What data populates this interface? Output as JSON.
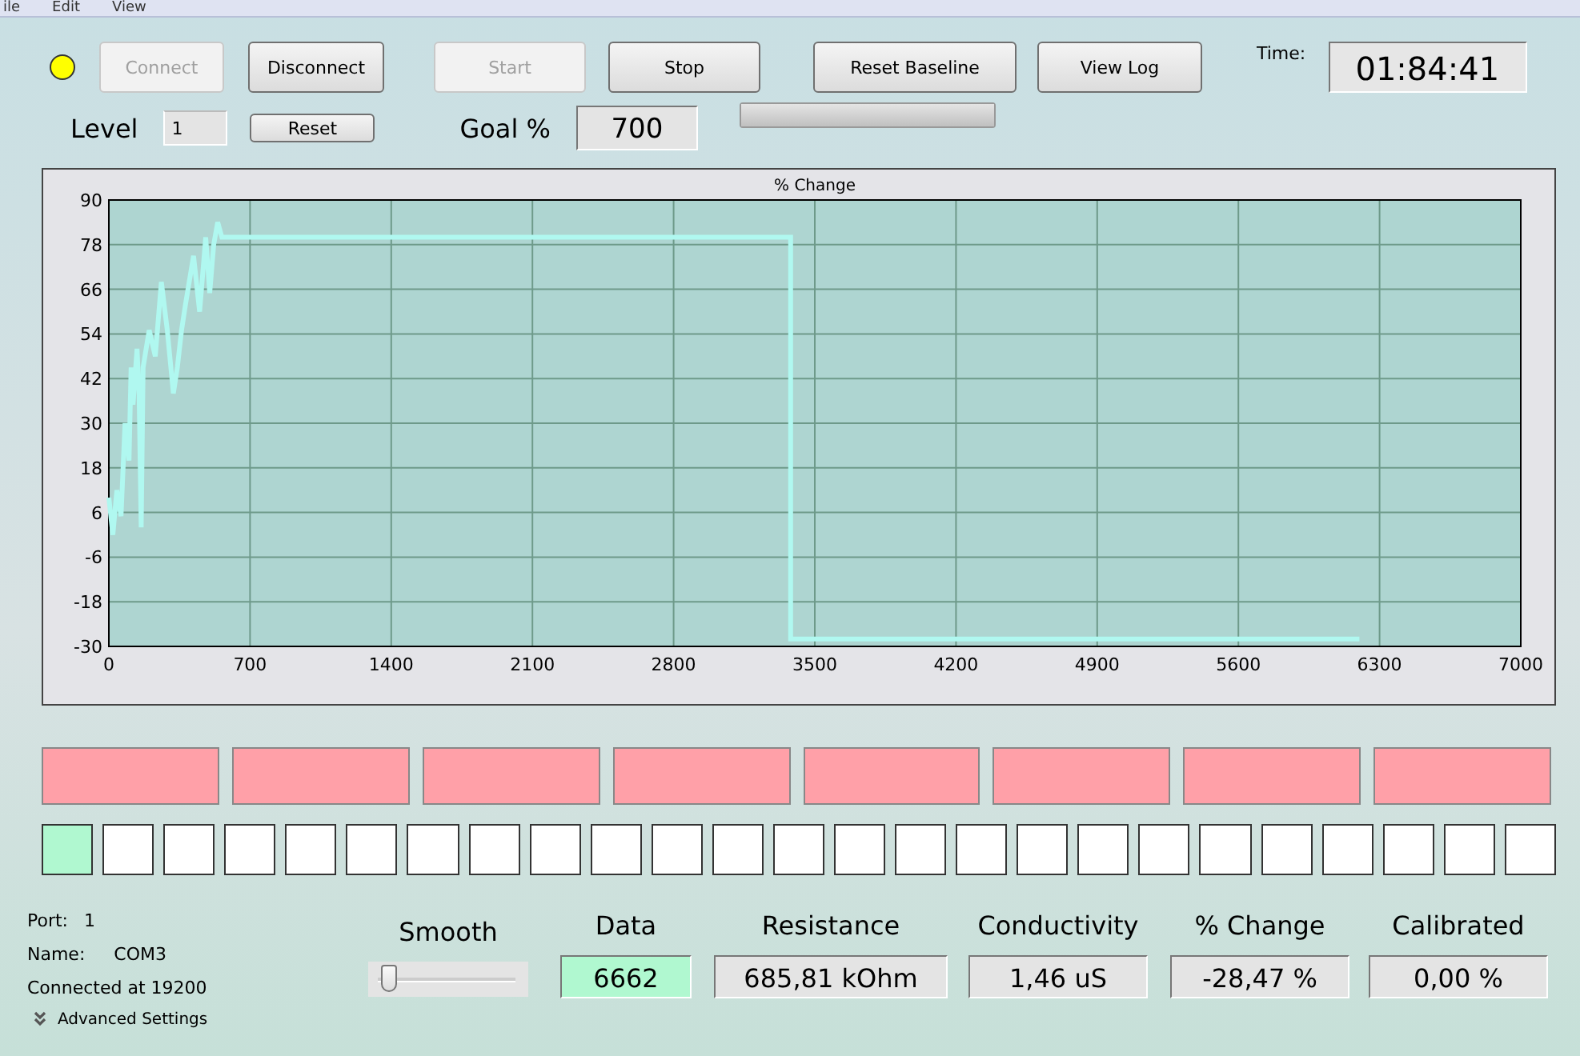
{
  "menu": [
    "ile",
    "Edit",
    "View"
  ],
  "status_dot": {
    "color": "#ffff00"
  },
  "buttons": [
    {
      "label": "Connect",
      "disabled": true
    },
    {
      "label": "Disconnect",
      "disabled": false
    },
    {
      "label": "Start",
      "disabled": true
    },
    {
      "label": "Stop",
      "disabled": false
    },
    {
      "label": "Reset Baseline",
      "disabled": false
    },
    {
      "label": "View Log",
      "disabled": false
    }
  ],
  "time": {
    "label": "Time:",
    "value": "01:84:41"
  },
  "level": {
    "label": "Level",
    "value": "1",
    "reset": "Reset"
  },
  "goal": {
    "label": "Goal %",
    "value": "700",
    "progress": {
      "level": 1
    }
  },
  "chart": {
    "chart_data": {
      "type": "line",
      "title": "% Change",
      "grid": true,
      "xlim": [
        0,
        7000
      ],
      "ylim": [
        -30,
        90
      ],
      "xticks": [
        0,
        700,
        1400,
        2100,
        2800,
        3500,
        4200,
        4900,
        5600,
        6300,
        7000
      ],
      "yticks": [
        -30,
        -18,
        -6,
        6,
        18,
        30,
        42,
        54,
        66,
        78,
        90
      ],
      "x": [
        0,
        20,
        40,
        60,
        80,
        100,
        110,
        120,
        140,
        150,
        160,
        170,
        200,
        230,
        260,
        290,
        320,
        340,
        360,
        380,
        420,
        450,
        480,
        500,
        520,
        540,
        560,
        3380,
        3380,
        6200
      ],
      "series": [
        {
          "color": "#b0f8f0",
          "values": [
            10,
            0,
            12,
            5,
            30,
            20,
            45,
            35,
            50,
            38,
            2,
            45,
            55,
            48,
            68,
            55,
            38,
            45,
            55,
            62,
            75,
            60,
            80,
            65,
            78,
            84,
            80,
            80,
            -28,
            -28
          ]
        }
      ]
    }
  },
  "indicators": [
    {
      "color": "#ffa0a8"
    },
    {
      "color": "#ffa0a8"
    },
    {
      "color": "#ffa0a8"
    },
    {
      "color": "#ffa0a8"
    },
    {
      "color": "#ffa0a8"
    },
    {
      "color": "#ffa0a8"
    },
    {
      "color": "#ffa0a8"
    },
    {
      "color": "#ffa0a8"
    }
  ],
  "lights": [
    {
      "on": true
    },
    {
      "on": false
    },
    {
      "on": false
    },
    {
      "on": false
    },
    {
      "on": false
    },
    {
      "on": false
    },
    {
      "on": false
    },
    {
      "on": false
    },
    {
      "on": false
    },
    {
      "on": false
    },
    {
      "on": false
    },
    {
      "on": false
    },
    {
      "on": false
    },
    {
      "on": false
    },
    {
      "on": false
    },
    {
      "on": false
    },
    {
      "on": false
    },
    {
      "on": false
    },
    {
      "on": false
    },
    {
      "on": false
    },
    {
      "on": false
    },
    {
      "on": false
    },
    {
      "on": false
    },
    {
      "on": false
    },
    {
      "on": false
    }
  ],
  "port": {
    "port_label": "Port:",
    "port_value": "1",
    "name_label": "Name:",
    "name_value": "COM3",
    "status": "Connected at 19200",
    "advanced": "Advanced Settings"
  },
  "smooth": {
    "label": "Smooth",
    "level": 0.05
  },
  "readouts": [
    {
      "label": "Data",
      "value": "6662",
      "highlight": true
    },
    {
      "label": "Resistance",
      "value": "685,81 kOhm",
      "highlight": false
    },
    {
      "label": "Conductivity",
      "value": "1,46 uS",
      "highlight": false
    },
    {
      "label": "% Change",
      "value": "-28,47 %",
      "highlight": false
    },
    {
      "label": "Calibrated",
      "value": "0,00 %",
      "highlight": false
    }
  ]
}
